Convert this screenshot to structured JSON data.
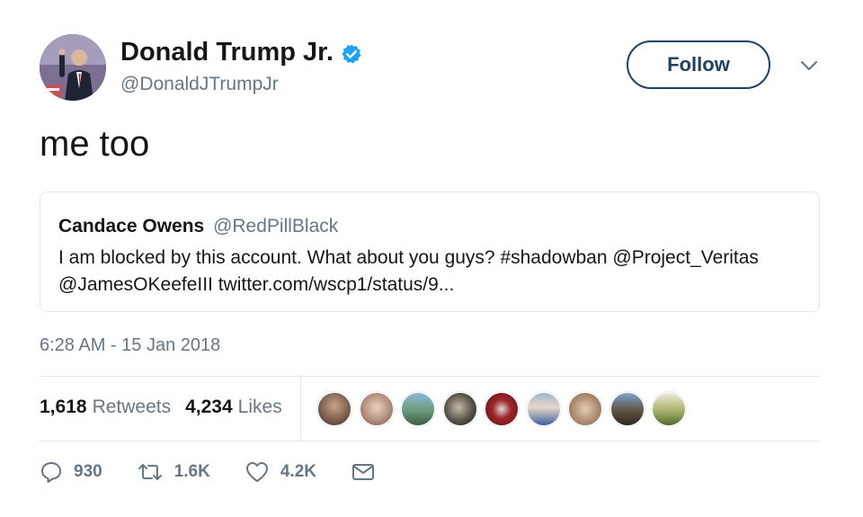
{
  "author": {
    "name": "Donald Trump Jr.",
    "handle": "@DonaldJTrumpJr",
    "verified": true
  },
  "header": {
    "follow_label": "Follow"
  },
  "tweet": {
    "text": "me too",
    "timestamp": "6:28 AM - 15 Jan 2018"
  },
  "quoted_tweet": {
    "author_name": "Candace Owens",
    "author_handle": "@RedPillBlack",
    "text": "I am blocked by this account. What about you guys? #shadowban @Project_Veritas @JamesOKeefeIII twitter.com/wscp1/status/9..."
  },
  "stats": {
    "retweets_count": "1,618",
    "retweets_label": "Retweets",
    "likes_count": "4,234",
    "likes_label": "Likes"
  },
  "actions": {
    "reply_count": "930",
    "retweet_count": "1.6K",
    "like_count": "4.2K"
  },
  "colors": {
    "follow_border": "#1c4164",
    "verified_blue": "#1da1f2",
    "secondary_text": "#657786",
    "divider": "#e1e8ed"
  },
  "icons": {
    "verified": "verified-badge-icon",
    "caret": "chevron-down-icon",
    "reply": "reply-icon",
    "retweet": "retweet-icon",
    "like": "heart-icon",
    "dm": "envelope-icon"
  }
}
